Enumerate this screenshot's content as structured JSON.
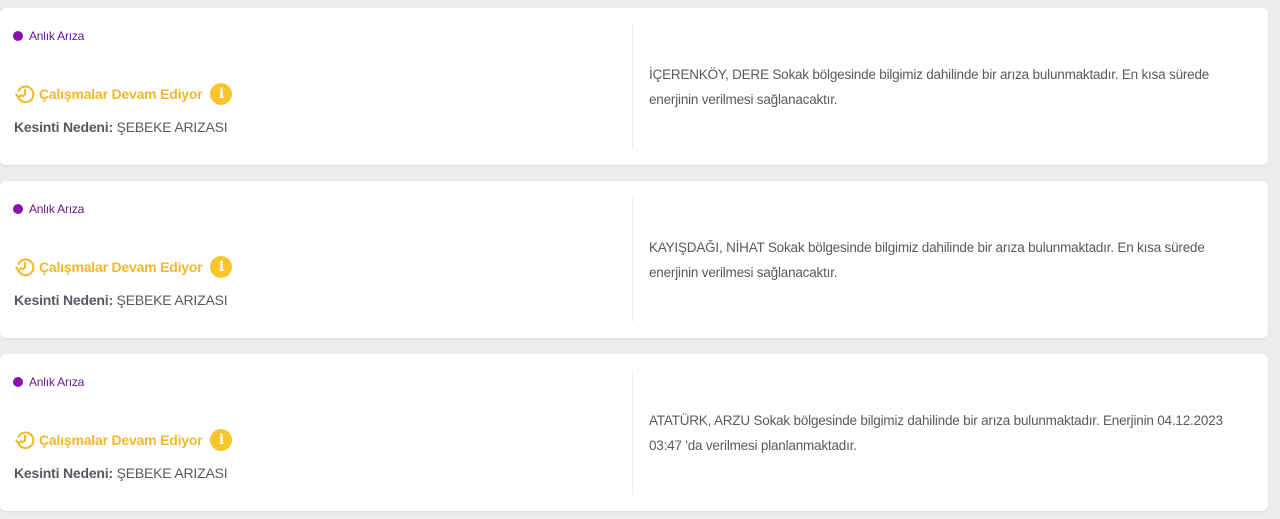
{
  "outages": [
    {
      "type_label": "Anlık Arıza",
      "status_label": "Çalışmalar Devam Ediyor",
      "reason_label": "Kesinti Nedeni:",
      "reason_value": "ŞEBEKE ARIZASI",
      "description": "İÇERENKÖY, DERE Sokak bölgesinde bilgimiz dahilinde bir arıza bulunmaktadır. En kısa sürede enerjinin verilmesi sağlanacaktır."
    },
    {
      "type_label": "Anlık Arıza",
      "status_label": "Çalışmalar Devam Ediyor",
      "reason_label": "Kesinti Nedeni:",
      "reason_value": "ŞEBEKE ARIZASI",
      "description": "KAYIŞDAĞI, NİHAT Sokak bölgesinde bilgimiz dahilinde bir arıza bulunmaktadır. En kısa sürede enerjinin verilmesi sağlanacaktır."
    },
    {
      "type_label": "Anlık Arıza",
      "status_label": "Çalışmalar Devam Ediyor",
      "reason_label": "Kesinti Nedeni:",
      "reason_value": "ŞEBEKE ARIZASI",
      "description": "ATATÜRK, ARZU Sokak bölgesinde bilgimiz dahilinde bir arıza bulunmaktadır. Enerjinin 04.12.2023 03:47 'da verilmesi planlanmaktadır."
    }
  ],
  "icons": {
    "status": "clock-refresh-icon",
    "info": "info-icon",
    "type": "purple-dot-icon"
  },
  "colors": {
    "type_dot": "#8a0fb0",
    "type_text": "#6b1496",
    "status": "#f5b72a",
    "info_bg": "#f8c62b",
    "text": "#5a5a5a",
    "background": "#ececee",
    "card": "#ffffff"
  },
  "info_glyph": "i"
}
